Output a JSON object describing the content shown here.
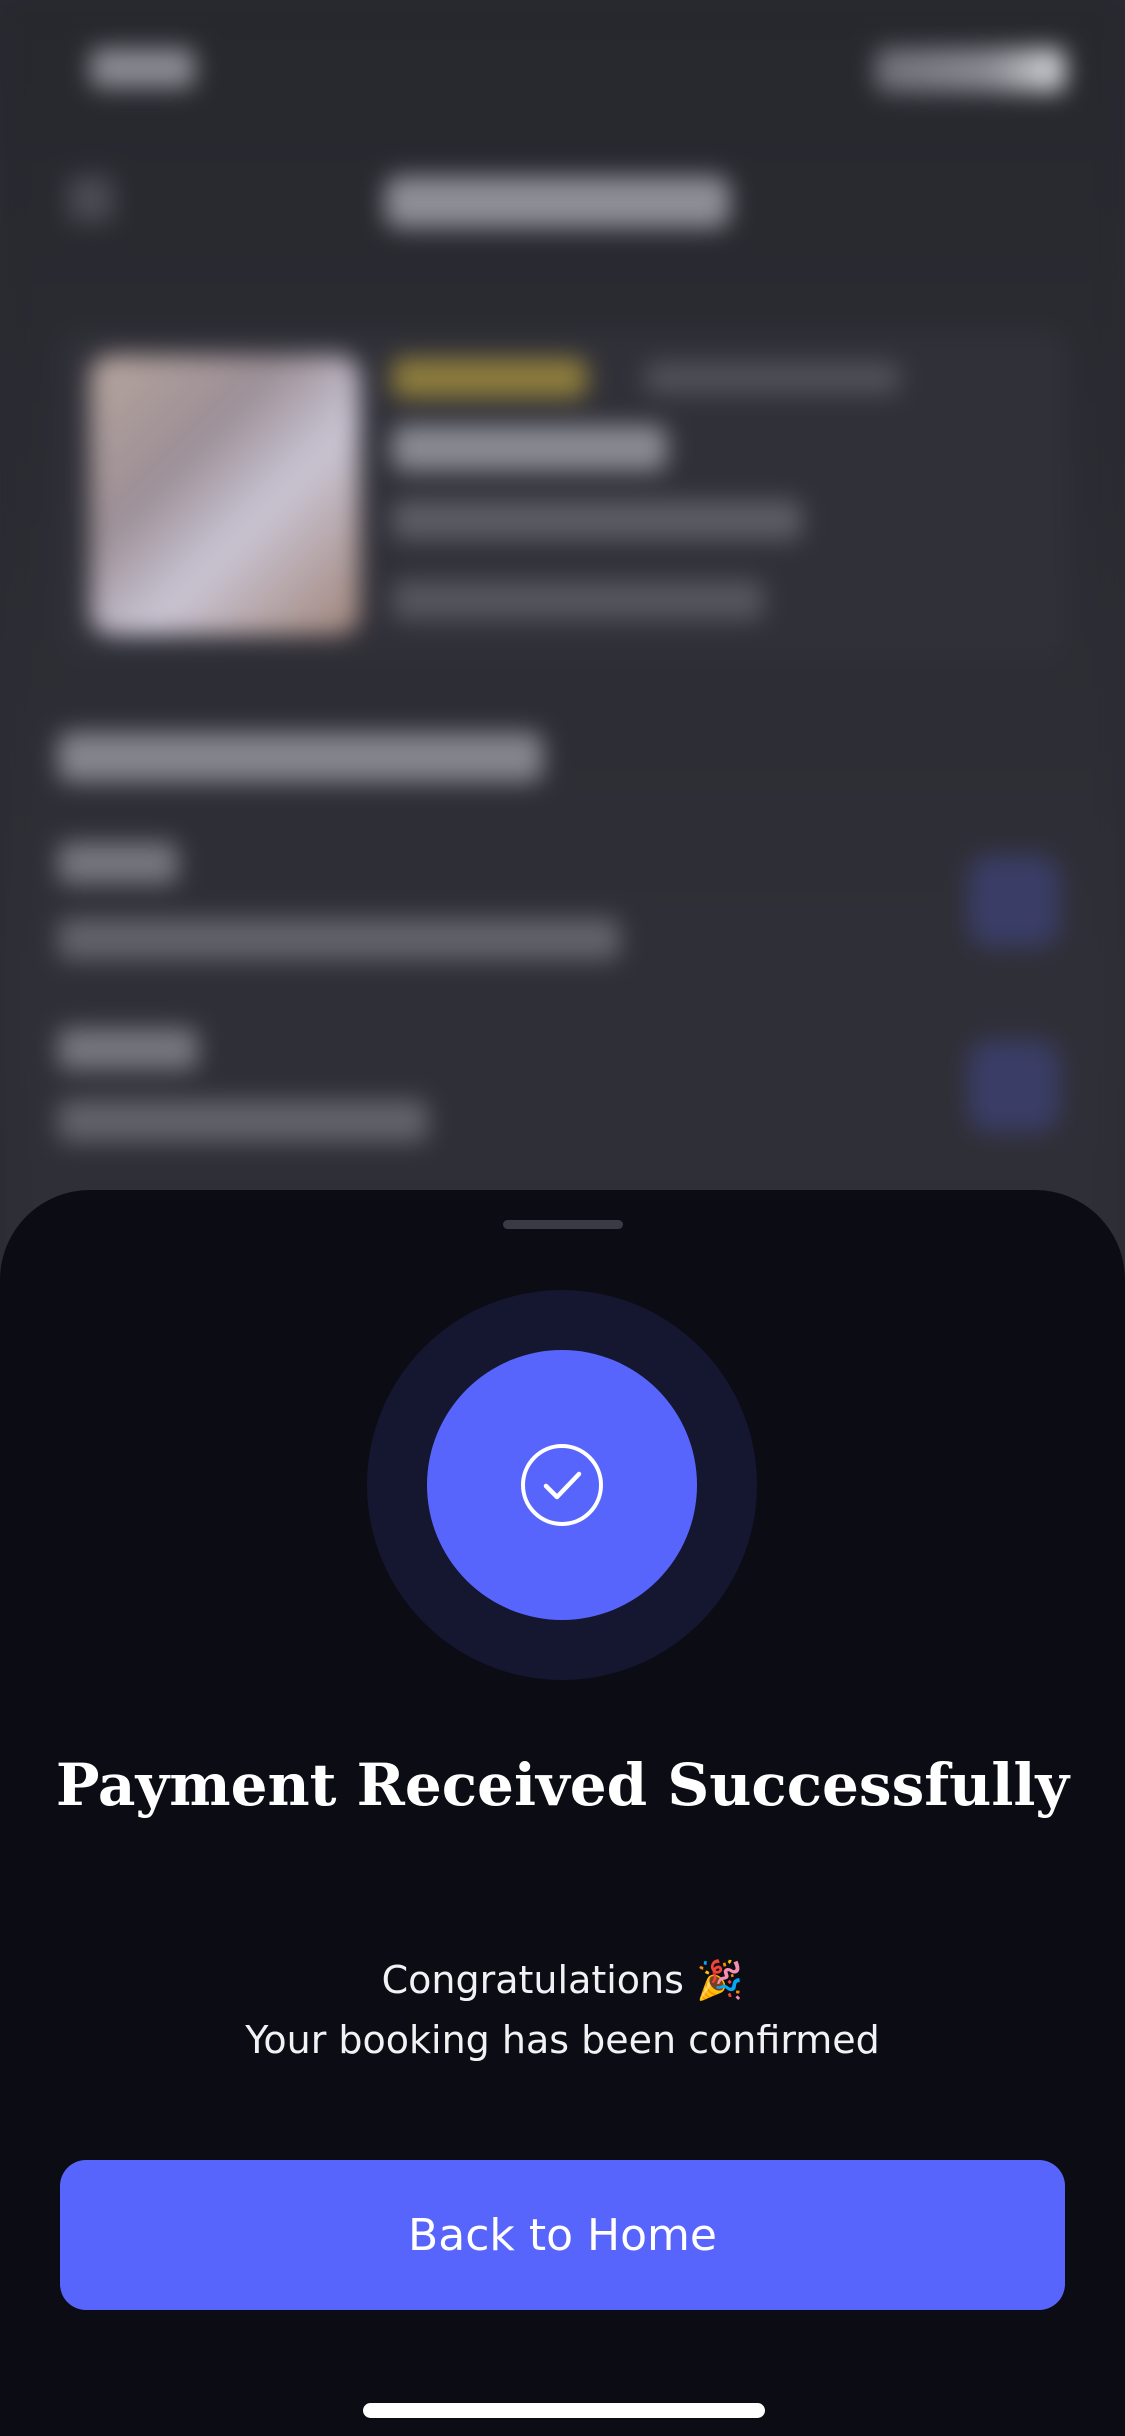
{
  "sheet": {
    "title": "Payment Received Successfully",
    "subtitle_line1": "Congratulations",
    "subtitle_emoji": "🎉",
    "subtitle_line2": "Your booking has been confirmed",
    "button_label": "Back to Home",
    "icon": "check-circle-icon"
  },
  "colors": {
    "accent": "#5865fc",
    "sheet_background": "#0c0c15",
    "ring": "#151630"
  }
}
